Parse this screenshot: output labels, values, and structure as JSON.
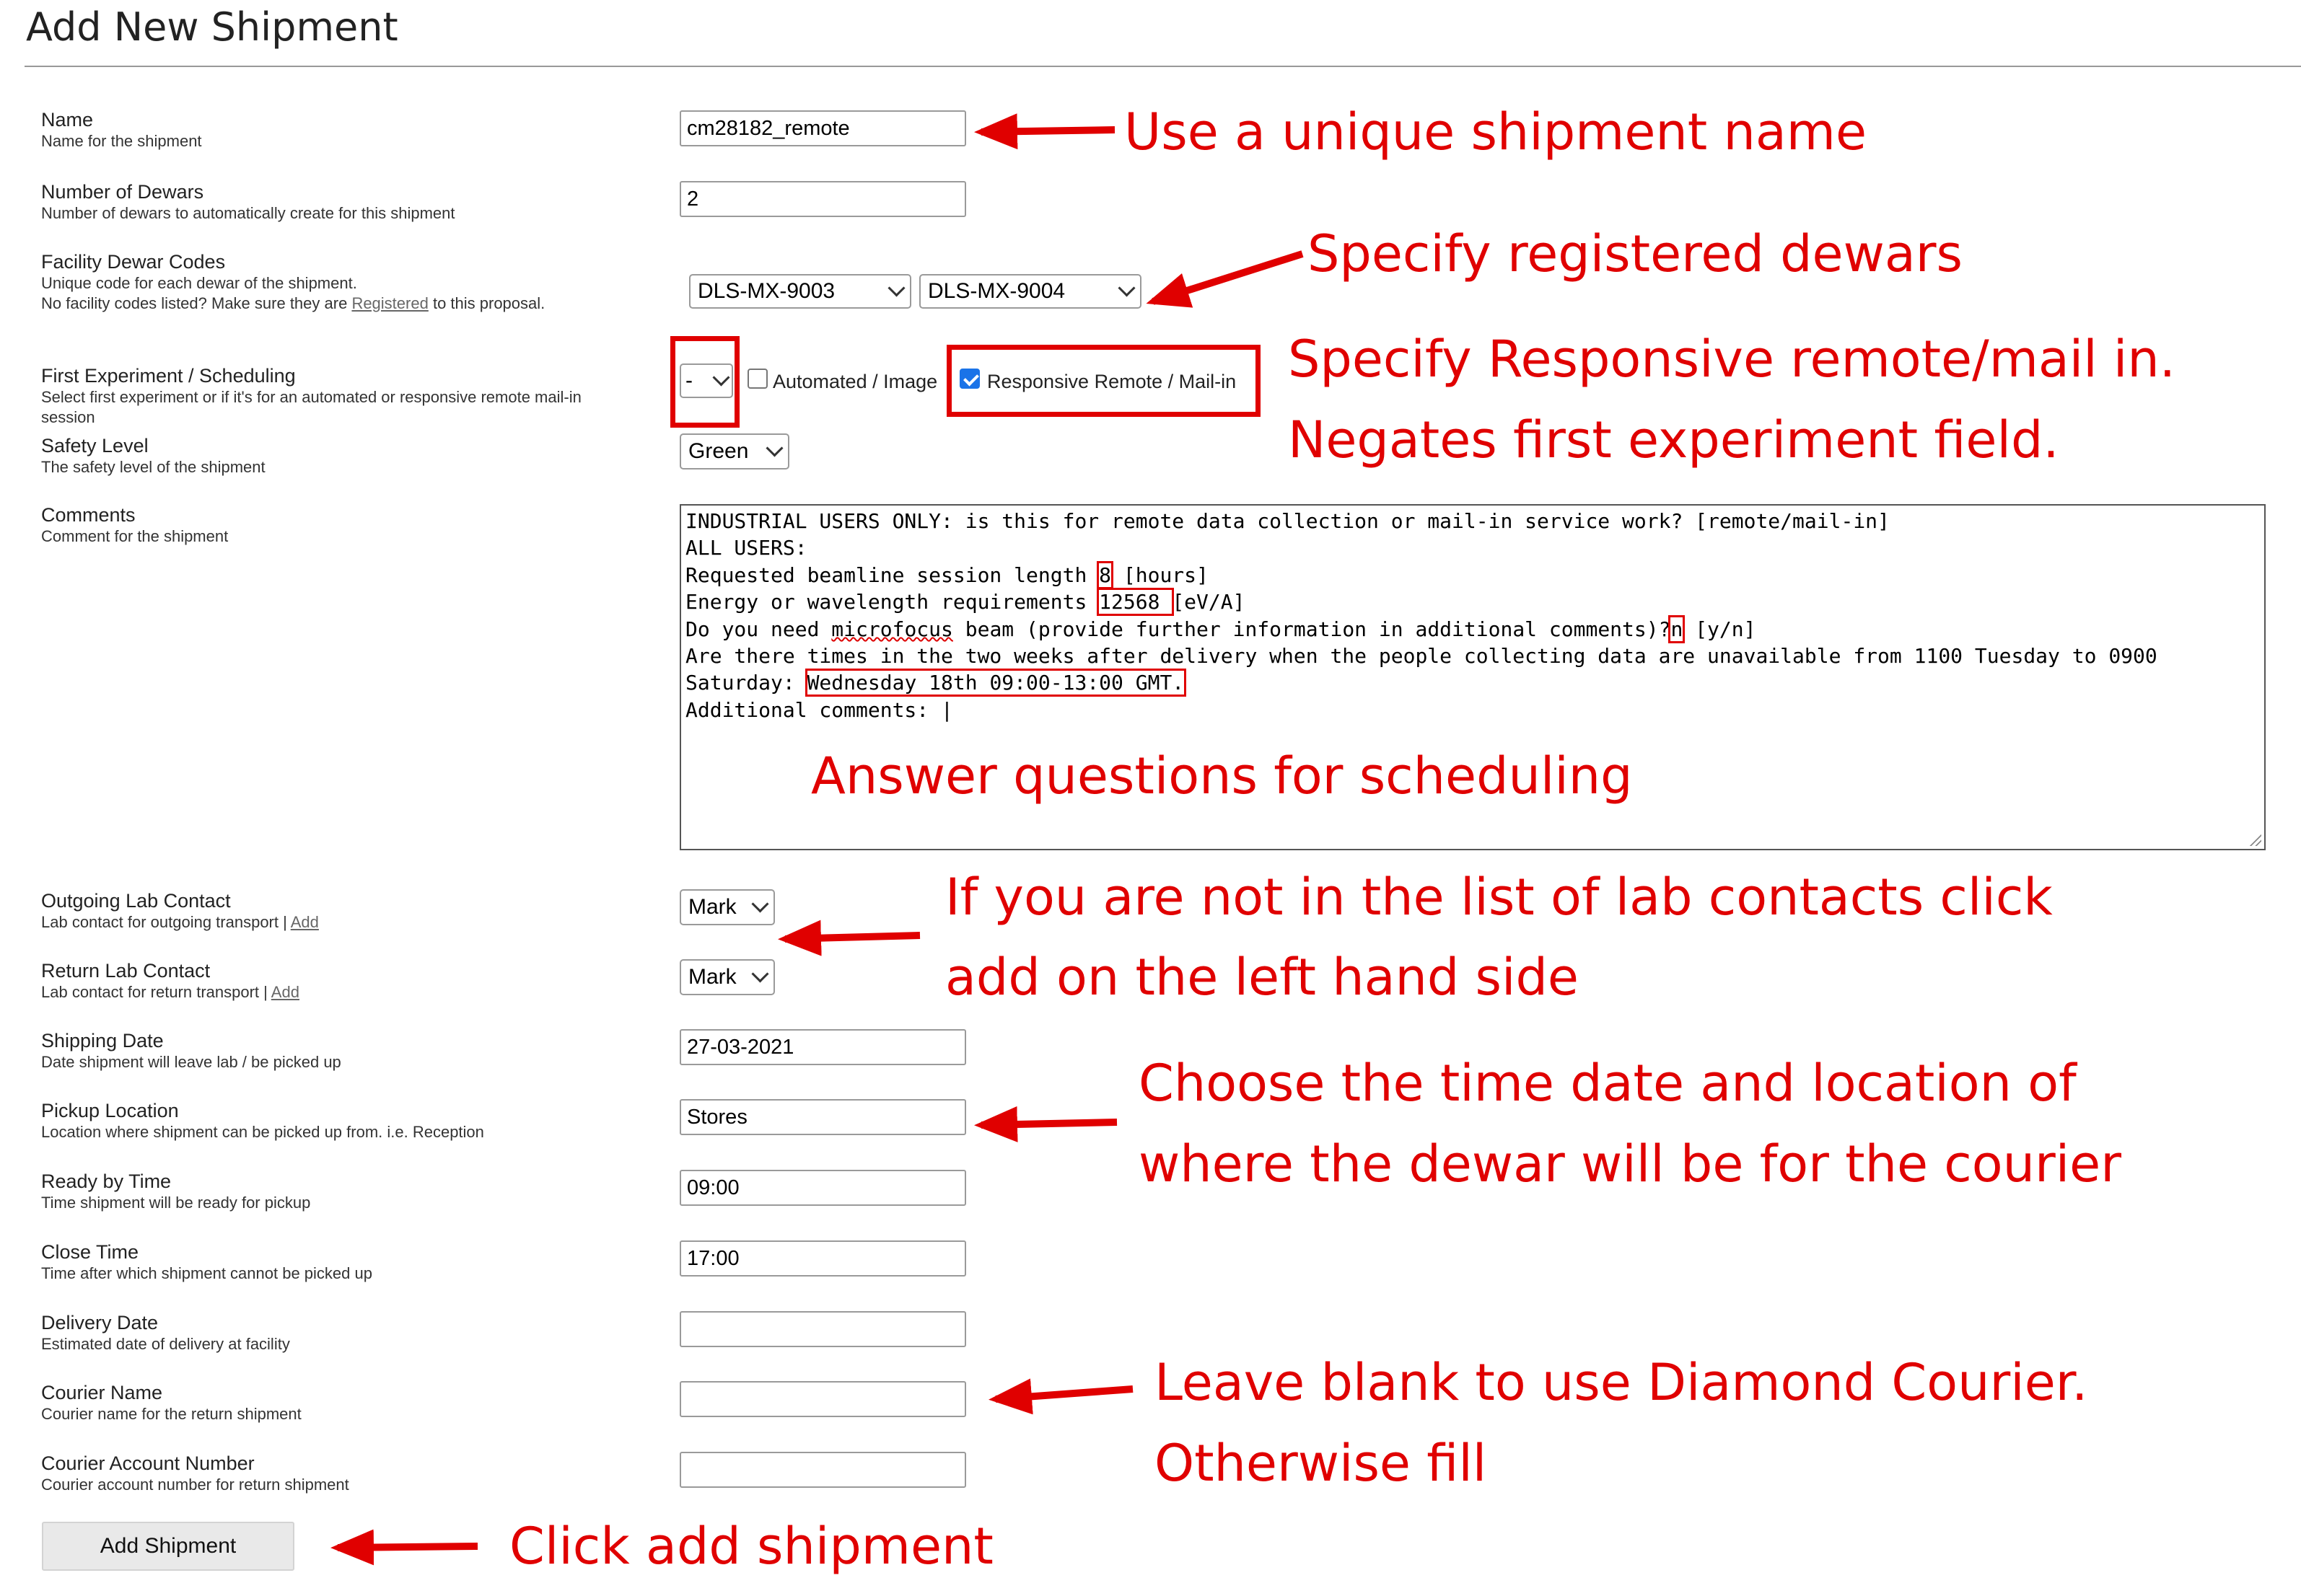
{
  "page": {
    "title": "Add New Shipment"
  },
  "fields": {
    "name": {
      "label": "Name",
      "help": "Name for the shipment",
      "value": "cm28182_remote"
    },
    "dewars": {
      "label": "Number of Dewars",
      "help": "Number of dewars to automatically create for this shipment",
      "value": "2"
    },
    "facility_codes": {
      "label": "Facility Dewar Codes",
      "help1": "Unique code for each dewar of the shipment.",
      "help2_pre": "No facility codes listed? Make sure they are",
      "help2_link": "Registered",
      "help2_post": "to this proposal.",
      "selected": [
        "DLS-MX-9003",
        "DLS-MX-9004"
      ]
    },
    "first_experiment": {
      "label": "First Experiment / Scheduling",
      "help1": "Select first experiment or if it's for an automated or responsive remote mail-in",
      "help2": "session",
      "select_value": "-",
      "automated_label": "Automated / Image",
      "automated_checked": false,
      "responsive_label": "Responsive Remote / Mail-in",
      "responsive_checked": true
    },
    "safety": {
      "label": "Safety Level",
      "help": "The safety level of the shipment",
      "value": "Green"
    },
    "comments": {
      "label": "Comments",
      "help": "Comment for the shipment",
      "line1": "INDUSTRIAL USERS ONLY: is this for remote data collection or mail-in service work? [remote/mail-in]",
      "line2": "ALL USERS:",
      "line3_pre": "Requested beamline session length",
      "line3_val": "8",
      "line3_post": "[hours]",
      "line4_pre": "Energy or wavelength requirements",
      "line4_val": "12568 ",
      "line4_post": "[eV/A]",
      "line5_a": "Do you need ",
      "line5_b": "microfocus",
      "line5_c": " beam (provide further information in additional comments)?",
      "line5_val": "n",
      "line5_post": "[y/n]",
      "line6": "Are there times in the two weeks after delivery when the people collecting data are unavailable from 1100 Tuesday to 0900",
      "line7_pre": "Saturday:",
      "line7_val": "Wednesday 18th 09:00-13:00 GMT.",
      "line8": "Additional comments: |"
    },
    "outgoing_contact": {
      "label": "Outgoing Lab Contact",
      "help": "Lab contact for outgoing transport |",
      "link": "Add",
      "value": "Mark"
    },
    "return_contact": {
      "label": "Return Lab Contact",
      "help": "Lab contact for return transport |",
      "link": "Add",
      "value": "Mark"
    },
    "shipping_date": {
      "label": "Shipping Date",
      "help": "Date shipment will leave lab / be picked up",
      "value": "27-03-2021"
    },
    "pickup_location": {
      "label": "Pickup Location",
      "help": "Location where shipment can be picked up from. i.e. Reception",
      "value": "Stores"
    },
    "ready_time": {
      "label": "Ready by Time",
      "help": "Time shipment will be ready for pickup",
      "value": "09:00"
    },
    "close_time": {
      "label": "Close Time",
      "help": "Time after which shipment cannot be picked up",
      "value": "17:00"
    },
    "delivery_date": {
      "label": "Delivery Date",
      "help": "Estimated date of delivery at facility",
      "value": ""
    },
    "courier_name": {
      "label": "Courier Name",
      "help": "Courier name for the return shipment",
      "value": ""
    },
    "courier_account": {
      "label": "Courier Account Number",
      "help": "Courier account number for return shipment",
      "value": ""
    }
  },
  "submit_label": "Add Shipment",
  "annotations": {
    "a1": "Use a unique shipment name",
    "a2": "Specify registered dewars",
    "a3": "Specify Responsive remote/mail in.",
    "a4": "Negates first experiment field.",
    "a5": "Answer questions for scheduling",
    "a6": "If you are not in the list of lab contacts click",
    "a7": "add on the left hand side",
    "a8": "Choose the time date and location of",
    "a9": "where the dewar will be for the courier",
    "a10": "Leave blank to use Diamond Courier.",
    "a11": "Otherwise fill",
    "a12": "Click add shipment"
  },
  "colors": {
    "annotation": "#e00000",
    "checkbox_on": "#1a73e8"
  },
  "icons": [
    "chevron-down-icon",
    "check-icon",
    "resize-grip-icon",
    "arrow-icon"
  ]
}
